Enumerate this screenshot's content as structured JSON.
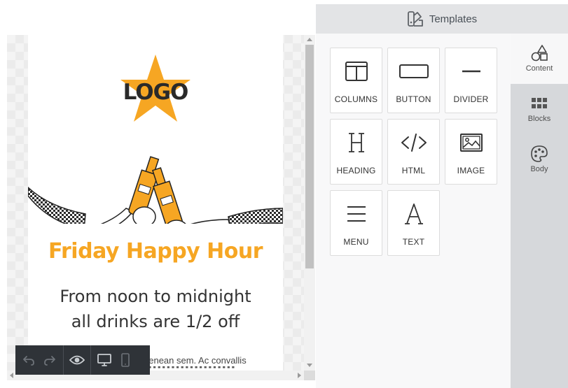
{
  "canvas": {
    "logo_text": "LOGO",
    "headline": "Friday Happy Hour",
    "subline": [
      "From noon to midnight",
      "all drinks are 1/2 off"
    ],
    "body_text": "aenean sem. Ac convallis",
    "colors": {
      "accent": "#f6a623",
      "dark": "#333333"
    }
  },
  "bottom_toolbar": {
    "buttons": [
      "undo-icon",
      "redo-icon",
      "preview-eye-icon",
      "desktop-view-icon",
      "mobile-view-icon"
    ]
  },
  "panel": {
    "header_label": "Templates",
    "tools": [
      {
        "label": "COLUMNS",
        "icon": "columns-icon"
      },
      {
        "label": "BUTTON",
        "icon": "button-icon"
      },
      {
        "label": "DIVIDER",
        "icon": "divider-icon"
      },
      {
        "label": "HEADING",
        "icon": "heading-icon"
      },
      {
        "label": "HTML",
        "icon": "code-icon"
      },
      {
        "label": "IMAGE",
        "icon": "image-icon"
      },
      {
        "label": "MENU",
        "icon": "menu-icon"
      },
      {
        "label": "TEXT",
        "icon": "text-icon"
      }
    ],
    "side_tabs": [
      {
        "label": "Content",
        "icon": "shapes-icon",
        "active": true
      },
      {
        "label": "Blocks",
        "icon": "blocks-grid-icon",
        "active": false
      },
      {
        "label": "Body",
        "icon": "palette-icon",
        "active": false
      }
    ]
  }
}
